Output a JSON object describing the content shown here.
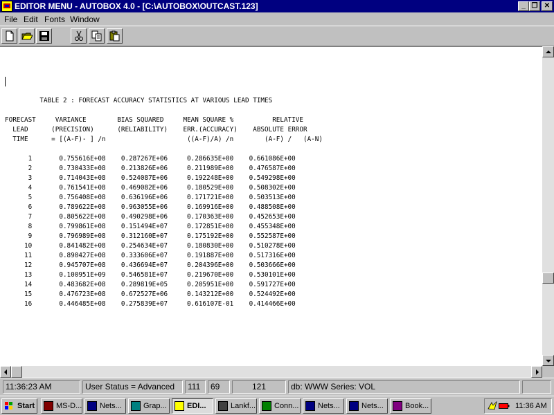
{
  "window": {
    "title": "EDITOR MENU - AUTOBOX 4.0 - [C:\\AUTOBOX\\OUTCAST.123]",
    "controls": [
      "_",
      "❐",
      "✕"
    ]
  },
  "menu": [
    "File",
    "Edit",
    "Fonts",
    "Window"
  ],
  "toolbar": [
    "new-document-icon",
    "open-folder-icon",
    "save-disk-icon",
    "cut-scissors-icon",
    "copy-icon",
    "paste-clipboard-icon"
  ],
  "report": {
    "title": "TABLE 2 : FORECAST ACCURACY STATISTICS AT VARIOUS LEAD TIMES",
    "header_lines": [
      "FORECAST     VARIANCE        BIAS SQUARED     MEAN SQUARE %          RELATIVE",
      "  LEAD      (PRECISION)      (RELIABILITY)    ERR.(ACCURACY)    ABSOLUTE ERROR",
      "  TIME      = [(A-F)- ] /n                     ((A-F)/A) /n        (A-F) /   (A-N)"
    ],
    "columns": [
      "FORECAST LEAD TIME",
      "VARIANCE (PRECISION)",
      "BIAS SQUARED (RELIABILITY)",
      "MEAN SQUARE % ERR.(ACCURACY)",
      "RELATIVE ABSOLUTE ERROR"
    ],
    "rows": [
      [
        "1",
        "0.755616E+08",
        "0.287267E+06",
        "0.286635E+00",
        "0.661086E+00"
      ],
      [
        "2",
        "0.730433E+08",
        "0.213826E+06",
        "0.211989E+00",
        "0.476587E+00"
      ],
      [
        "3",
        "0.714043E+08",
        "0.524087E+06",
        "0.192248E+00",
        "0.549298E+00"
      ],
      [
        "4",
        "0.761541E+08",
        "0.469082E+06",
        "0.180529E+00",
        "0.508302E+00"
      ],
      [
        "5",
        "0.756408E+08",
        "0.636196E+06",
        "0.171721E+00",
        "0.503513E+00"
      ],
      [
        "6",
        "0.789622E+08",
        "0.963055E+06",
        "0.169916E+00",
        "0.488508E+00"
      ],
      [
        "7",
        "0.805622E+08",
        "0.490298E+06",
        "0.170363E+00",
        "0.452653E+00"
      ],
      [
        "8",
        "0.799861E+08",
        "0.151494E+07",
        "0.172851E+00",
        "0.455348E+00"
      ],
      [
        "9",
        "0.796989E+08",
        "0.312160E+07",
        "0.175192E+00",
        "0.552587E+00"
      ],
      [
        "10",
        "0.841482E+08",
        "0.254634E+07",
        "0.180830E+00",
        "0.510278E+00"
      ],
      [
        "11",
        "0.890427E+08",
        "0.333606E+07",
        "0.191887E+00",
        "0.517316E+00"
      ],
      [
        "12",
        "0.945707E+08",
        "0.436694E+07",
        "0.204396E+00",
        "0.503666E+00"
      ],
      [
        "13",
        "0.100951E+09",
        "0.546581E+07",
        "0.219670E+00",
        "0.530101E+00"
      ],
      [
        "14",
        "0.483682E+08",
        "0.289819E+05",
        "0.205951E+00",
        "0.591727E+00"
      ],
      [
        "15",
        "0.476723E+08",
        "0.672527E+06",
        "0.143212E+00",
        "0.524492E+00"
      ],
      [
        "16",
        "0.446485E+08",
        "0.275839E+07",
        "0.616107E-01",
        "0.414466E+00"
      ]
    ]
  },
  "status": {
    "time": "11:36:23 AM",
    "user_status": "User Status = Advanced",
    "field_a": "111",
    "field_b": "69",
    "field_c": "121",
    "db": "db: WWW Series: VOL"
  },
  "taskbar": {
    "start": "Start",
    "tasks": [
      {
        "label": "MS-D...",
        "icon": "ms-dos-icon",
        "active": false
      },
      {
        "label": "Nets...",
        "icon": "netscape-icon",
        "active": false
      },
      {
        "label": "Grap...",
        "icon": "graph-icon",
        "active": false
      },
      {
        "label": "EDI...",
        "icon": "autobox-editor-icon",
        "active": true
      },
      {
        "label": "Lankf...",
        "icon": "phone-icon",
        "active": false
      },
      {
        "label": "Conn...",
        "icon": "connection-icon",
        "active": false
      },
      {
        "label": "Nets...",
        "icon": "netscape-icon",
        "active": false
      },
      {
        "label": "Nets...",
        "icon": "netscape-icon",
        "active": false
      },
      {
        "label": "Book...",
        "icon": "book-icon",
        "active": false
      }
    ],
    "clock": "11:36 AM"
  }
}
